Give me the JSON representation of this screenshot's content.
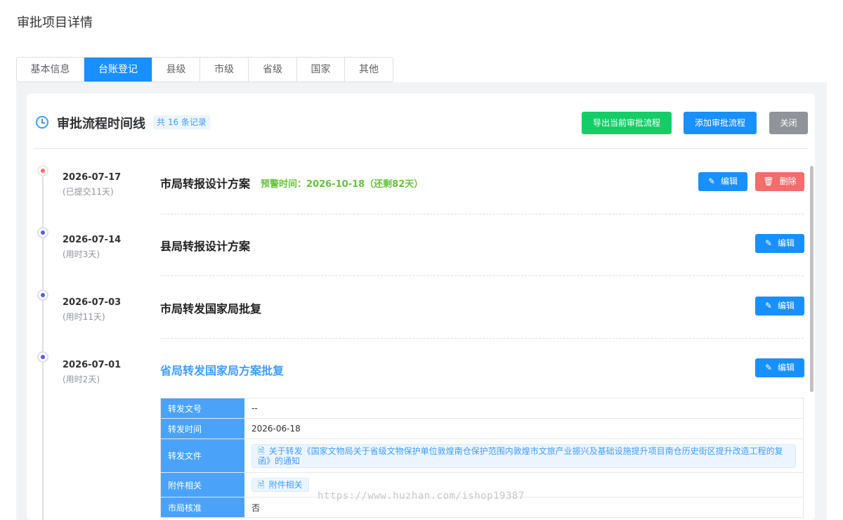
{
  "dialog": {
    "title": "审批项目详情"
  },
  "tabs": [
    {
      "label": "基本信息"
    },
    {
      "label": "台账登记"
    },
    {
      "label": "县级"
    },
    {
      "label": "市级"
    },
    {
      "label": "省级"
    },
    {
      "label": "国家"
    },
    {
      "label": "其他"
    }
  ],
  "active_tab": "台账登记",
  "card": {
    "title": "审批流程时间线",
    "count_tag": "共 16 条记录",
    "export_label": "导出当前审批流程",
    "add_label": "添加审批流程",
    "close_label": "关闭"
  },
  "timeline": [
    {
      "date": "2026-07-17",
      "sub": "(已提交11天)",
      "title": "市局转报设计方案",
      "warning": "预警时间：2026-10-18（还剩82天）",
      "edit_label": "编辑",
      "delete_label": "删除"
    },
    {
      "date": "2026-07-14",
      "sub": "(用时3天)",
      "title": "县局转报设计方案",
      "edit_label": "编辑"
    },
    {
      "date": "2026-07-03",
      "sub": "(用时11天)",
      "title": "市局转发国家局批复",
      "edit_label": "编辑"
    },
    {
      "date": "2026-07-01",
      "sub": "(用时2天)",
      "title": "省局转发国家局方案批复",
      "edit_label": "编辑"
    }
  ],
  "detail": {
    "rows": [
      {
        "label": "转发文号",
        "value": "--"
      },
      {
        "label": "转发时间",
        "value": "2026-06-18"
      },
      {
        "label": "转发文件",
        "value": "关于转发《国家文物局关于省级文物保护单位敦煌南仓保护范围内敦煌市文旅产业振兴及基础设施提升项目南仓历史街区提升改造工程的复函》的通知"
      },
      {
        "label": "附件相关",
        "value": "附件相关"
      },
      {
        "label": "市局核准",
        "value": "否"
      }
    ]
  },
  "watermark": "https://www.huzhan.com/ishop19387",
  "colors": {
    "primary": "#1890ff",
    "success": "#13ce66",
    "danger": "#f56c6c",
    "info": "#909399",
    "detail_label_bg": "#4aa3f8"
  },
  "icons": {
    "header": "clock-icon",
    "edit": "pencil-icon",
    "delete": "trash-icon",
    "file": "document-icon"
  }
}
